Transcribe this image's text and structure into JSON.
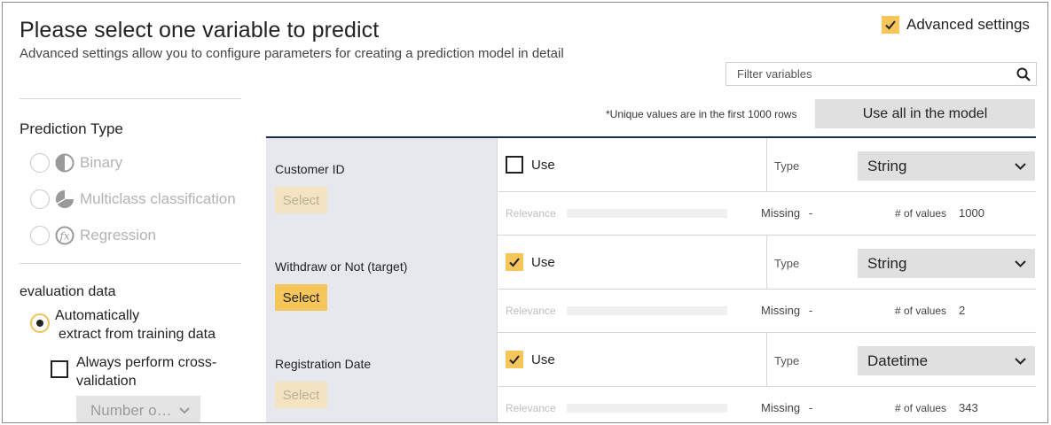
{
  "header": {
    "title": "Please select one variable to predict",
    "subtitle": "Advanced settings allow you to configure parameters for creating a prediction model in detail"
  },
  "advanced_settings": {
    "label": "Advanced settings",
    "checked": true
  },
  "filter": {
    "placeholder": "Filter variables",
    "value": ""
  },
  "note": "*Unique values are in the first 1000 rows",
  "use_all_button": "Use all in the model",
  "prediction_type": {
    "heading": "Prediction Type",
    "options": [
      {
        "label": "Binary",
        "icon": "binary-icon",
        "selected": false,
        "disabled": true
      },
      {
        "label": "Multiclass classification",
        "icon": "multiclass-icon",
        "selected": false,
        "disabled": true
      },
      {
        "label": "Regression",
        "icon": "regression-icon",
        "selected": false,
        "disabled": true
      }
    ]
  },
  "evaluation_data": {
    "heading": "evaluation data",
    "auto_option": {
      "line1": "Automatically",
      "line2": "extract from training data",
      "selected": true
    },
    "cross_validation": {
      "line1": "Always perform cross-",
      "line2": "validation",
      "checked": false
    },
    "number_select": "Number o…"
  },
  "variables": [
    {
      "name": "Customer ID",
      "select_label": "Select",
      "select_active": false,
      "use_label": "Use",
      "use_checked": false,
      "type_label": "Type",
      "type_value": "String",
      "relevance_label": "Relevance",
      "missing_label": "Missing",
      "missing_value": "-",
      "values_label": "# of values",
      "values_count": "1000"
    },
    {
      "name": "Withdraw or Not (target)",
      "select_label": "Select",
      "select_active": true,
      "use_label": "Use",
      "use_checked": true,
      "type_label": "Type",
      "type_value": "String",
      "relevance_label": "Relevance",
      "missing_label": "Missing",
      "missing_value": "-",
      "values_label": "# of values",
      "values_count": "2"
    },
    {
      "name": "Registration Date",
      "select_label": "Select",
      "select_active": false,
      "use_label": "Use",
      "use_checked": true,
      "type_label": "Type",
      "type_value": "Datetime",
      "relevance_label": "Relevance",
      "missing_label": "Missing",
      "missing_value": "-",
      "values_label": "# of values",
      "values_count": "343"
    }
  ],
  "colors": {
    "accent": "#f6c65b",
    "accent_dim": "#f4e3c0",
    "table_header_border": "#1c2b4a",
    "variable_cell_bg": "#e7e8ee",
    "control_bg": "#e0e0e0"
  }
}
